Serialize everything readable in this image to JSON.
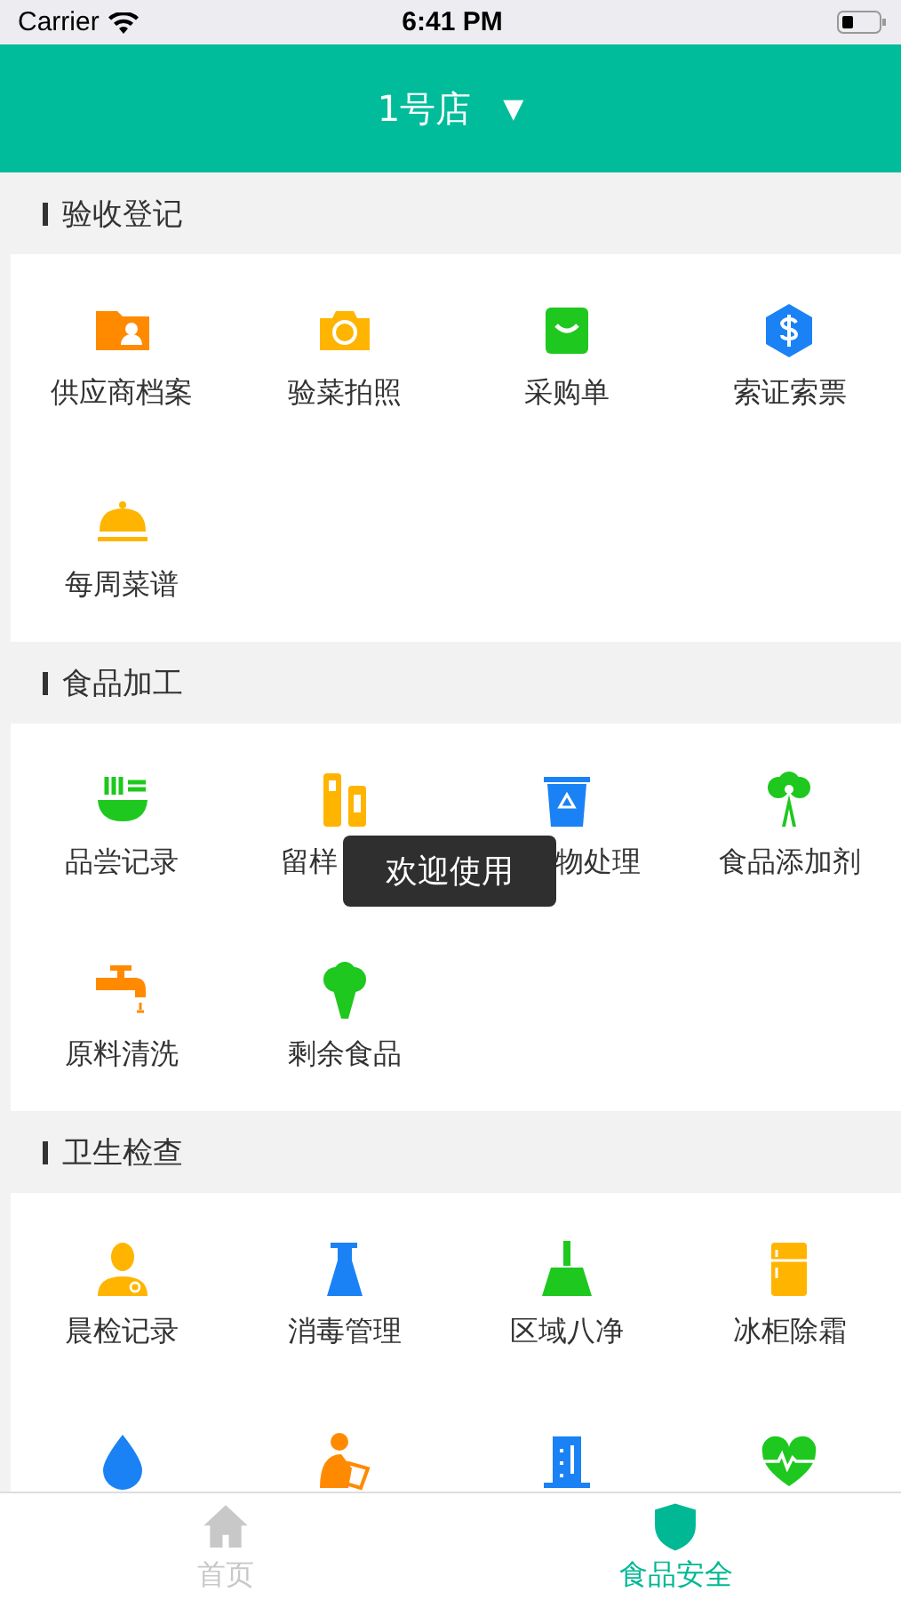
{
  "status_bar": {
    "carrier": "Carrier",
    "time": "6:41 PM"
  },
  "header": {
    "title": "1号店",
    "dropdown_icon": "▼"
  },
  "sections": [
    {
      "title": "验收登记",
      "items": [
        {
          "kind": "entry",
          "label": "供应商档案"
        },
        {
          "kind": "entry",
          "label": "验菜拍照"
        },
        {
          "kind": "entry",
          "label": "采购单"
        },
        {
          "kind": "entry",
          "label": "索证索票"
        },
        {
          "kind": "entry",
          "label": "每周菜谱"
        }
      ]
    },
    {
      "title": "食品加工",
      "items": [
        {
          "kind": "entry",
          "label": "品尝记录"
        },
        {
          "kind": "cut_end",
          "label": "留样"
        },
        {
          "kind": "cut_start",
          "label": "物处理"
        },
        {
          "kind": "entry",
          "label": "食品添加剂"
        },
        {
          "kind": "entry",
          "label": "原料清洗"
        },
        {
          "kind": "entry",
          "label": "剩余食品"
        }
      ]
    },
    {
      "title": "卫生检查",
      "items": [
        {
          "kind": "entry",
          "label": "晨检记录"
        },
        {
          "kind": "entry",
          "label": "消毒管理"
        },
        {
          "kind": "entry",
          "label": "区域八净"
        },
        {
          "kind": "entry",
          "label": "冰柜除霜"
        },
        {
          "kind": "icon_only"
        },
        {
          "kind": "icon_only"
        },
        {
          "kind": "icon_only"
        },
        {
          "kind": "icon_only"
        }
      ]
    }
  ],
  "toast": {
    "text": "欢迎使用"
  },
  "tab_bar": [
    {
      "label": "首页",
      "selected": false
    },
    {
      "label": "食品安全",
      "selected": true
    }
  ]
}
